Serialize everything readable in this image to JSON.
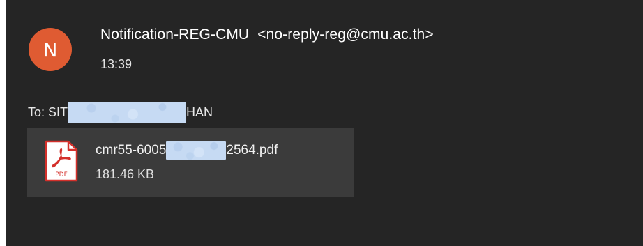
{
  "sender": {
    "avatar_initial": "N",
    "name": "Notification-REG-CMU",
    "email": "<no-reply-reg@cmu.ac.th>"
  },
  "time": "13:39",
  "to": {
    "prefix": "To: SIT",
    "suffix": "HAN"
  },
  "attachment": {
    "name_prefix": "cmr55-6005",
    "name_suffix": "2564.pdf",
    "size": "181.46 KB",
    "icon": "pdf-icon",
    "icon_label": "PDF"
  },
  "colors": {
    "background": "#252525",
    "avatar": "#df5b32",
    "attachment_card": "#3b3b3b",
    "redaction": "#c6daf3",
    "pdf_red": "#d4302b"
  }
}
